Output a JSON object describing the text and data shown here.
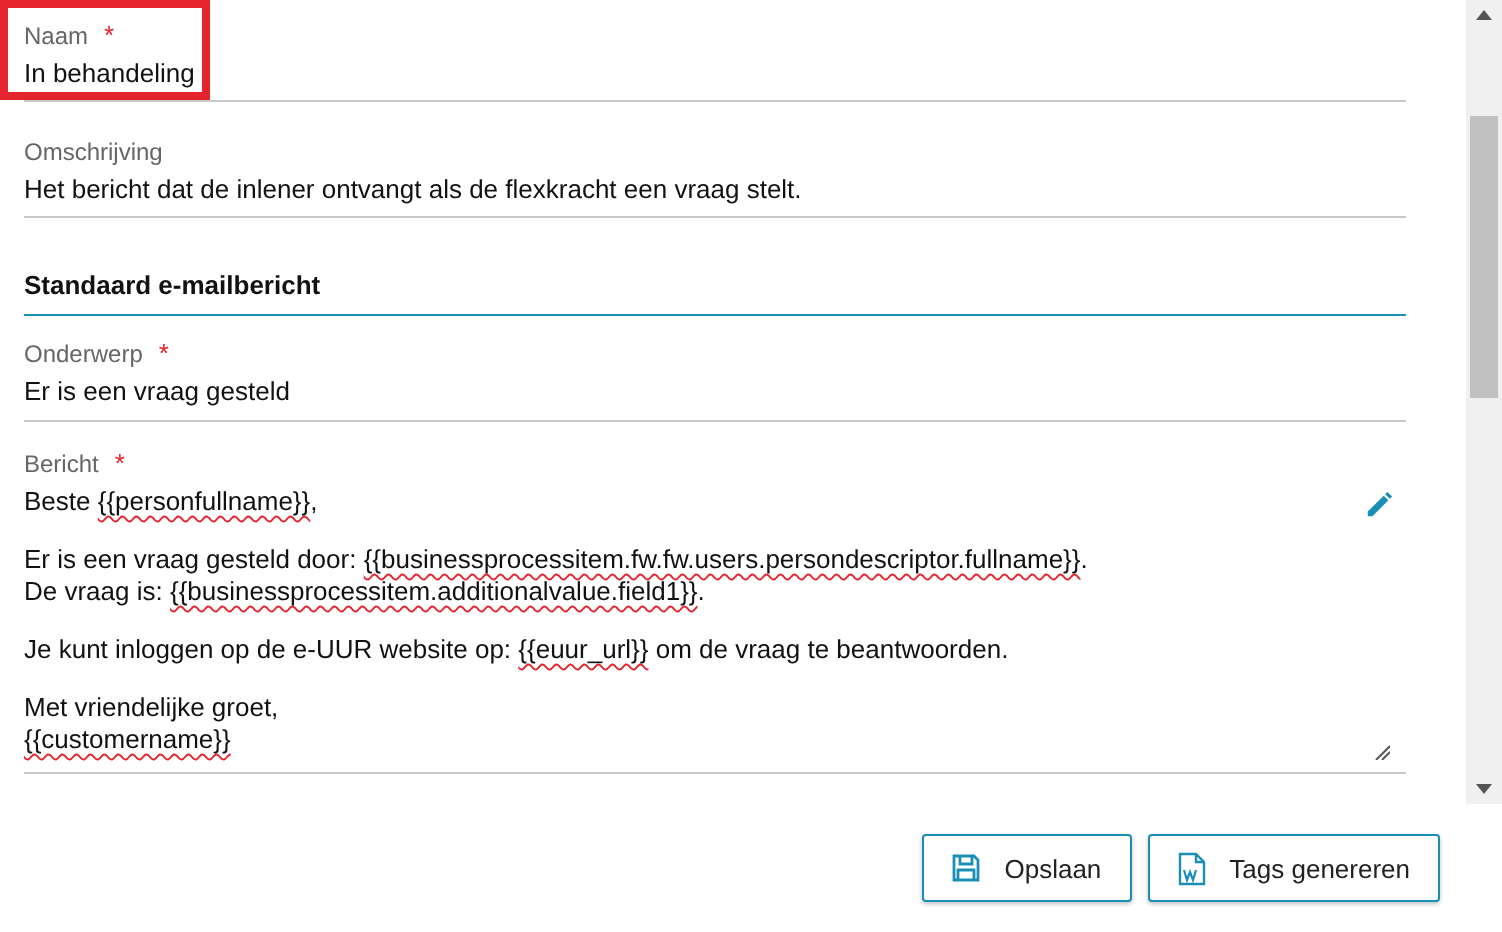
{
  "fields": [
    {
      "label": "Naam",
      "required_mark": "*",
      "value": "In behandeling",
      "highlighted": true
    },
    {
      "label": "Omschrijving",
      "value": "Het bericht dat de inlener ontvangt als de flexkracht een vraag stelt.",
      "highlighted": false
    }
  ],
  "section": {
    "title": "Standaard e-mailbericht"
  },
  "subject": {
    "label": "Onderwerp",
    "required_mark": "*",
    "value": "Er is een vraag gesteld"
  },
  "message": {
    "label": "Bericht",
    "required_mark": "*",
    "paragraphs": [
      [
        [
          {
            "text": "Beste "
          },
          {
            "text": "{{personfullname}}",
            "misspelled": true
          },
          {
            "text": ","
          }
        ]
      ],
      [
        [
          {
            "text": "Er is een vraag gesteld door: "
          },
          {
            "text": "{{businessprocessitem.fw.fw.users.persondescriptor.fullname}}",
            "misspelled": true
          },
          {
            "text": "."
          }
        ],
        [
          {
            "text": "De vraag is: "
          },
          {
            "text": "{{businessprocessitem.additionalvalue.field1}}",
            "misspelled": true
          },
          {
            "text": "."
          }
        ]
      ],
      [
        [
          {
            "text": "Je kunt inloggen op de e-UUR website op: "
          },
          {
            "text": "{{euur_url}}",
            "misspelled": true
          },
          {
            "text": " om de vraag te beantwoorden."
          }
        ]
      ],
      [
        [
          {
            "text": "Met vriendelijke groet,"
          }
        ],
        [
          {
            "text": "{{customername}}",
            "misspelled": true
          }
        ]
      ]
    ]
  },
  "buttons": [
    {
      "label": "Opslaan",
      "kind": "save"
    },
    {
      "label": "Tags genereren",
      "kind": "word"
    }
  ]
}
